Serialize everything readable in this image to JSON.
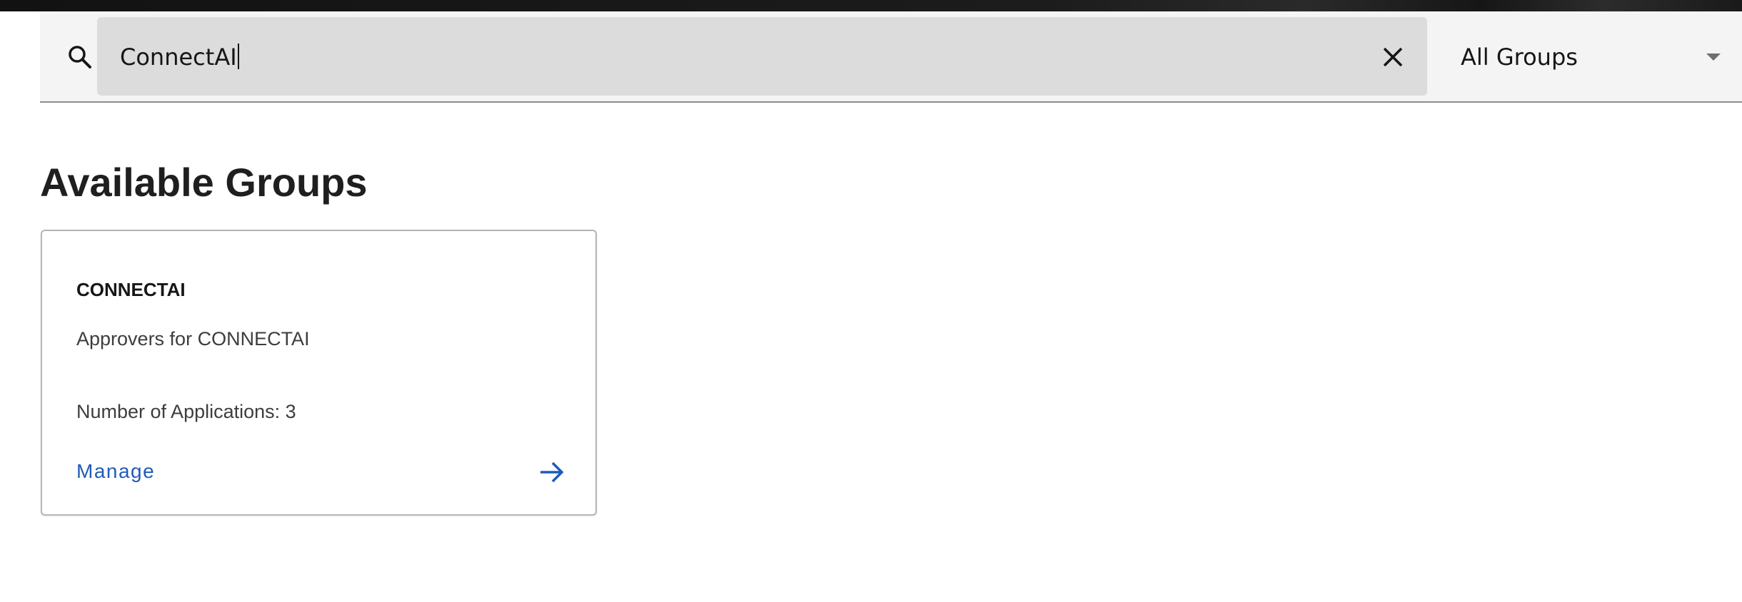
{
  "search": {
    "value": "ConnectAI",
    "icon": "search-icon",
    "clear_icon": "close-icon"
  },
  "group_filter": {
    "selected": "All Groups",
    "icon": "caret-down-icon"
  },
  "main": {
    "title": "Available Groups"
  },
  "groups": [
    {
      "name": "CONNECTAI",
      "description": "Approvers for CONNECTAI",
      "count_label": "Number of Applications: 3",
      "action_label": "Manage",
      "action_icon": "arrow-right-icon"
    }
  ],
  "colors": {
    "link": "#1f5bb8",
    "search_background": "#dcdcdc",
    "bar_background": "#f4f4f4"
  }
}
